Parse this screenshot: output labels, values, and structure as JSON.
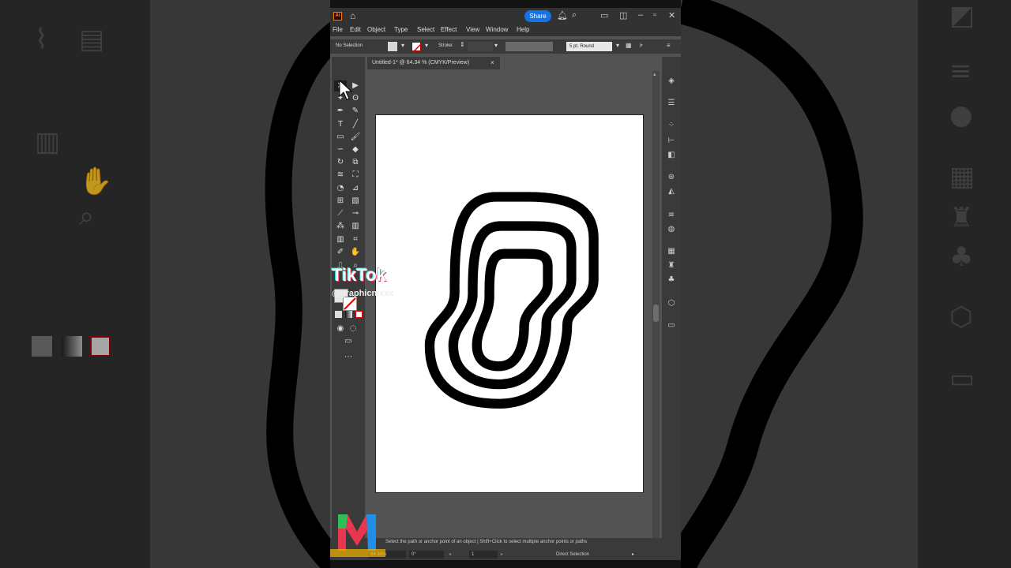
{
  "window": {
    "share_label": "Share"
  },
  "menu": [
    "File",
    "Edit",
    "Object",
    "Type",
    "Select",
    "Effect",
    "View",
    "Window",
    "Help"
  ],
  "control_bar": {
    "selection_label": "No Selection",
    "stroke_label": "Stroke:",
    "brush_label": "5 pt. Round"
  },
  "document": {
    "tab_title": "Untitled-1* @ 64.34 % (CMYK/Preview)",
    "close_label": "×"
  },
  "status": {
    "hint": "Select the path or anchor point of an object  |  Shift+Click to select multiple anchor points or paths",
    "zoom": "64.34%",
    "rotation": "0°",
    "page": "1",
    "mode": "Direct Selection"
  },
  "overlay": {
    "watermark_brand": "TikTok",
    "watermark_handle": "@graphicnixxx"
  },
  "colors": {
    "accent": "#1473e6",
    "app_bg": "#535353",
    "panel_bg": "#3a3a3a",
    "titlebar_bg": "#323232",
    "stroke": "#000000"
  },
  "icons": {
    "toolbar": [
      "selection-tool",
      "direct-selection-tool",
      "magic-wand-tool",
      "lasso-tool",
      "pen-tool",
      "curvature-tool",
      "type-tool",
      "line-tool",
      "rectangle-tool",
      "paintbrush-tool",
      "shaper-tool",
      "eraser-tool",
      "rotate-tool",
      "scale-tool",
      "warp-tool",
      "free-transform-tool",
      "shape-builder-tool",
      "perspective-tool",
      "mesh-tool",
      "gradient-tool",
      "eyedropper-tool",
      "blend-tool",
      "symbol-sprayer-tool",
      "graph-tool",
      "artboard-tool",
      "slice-tool",
      "hand-tool",
      "zoom-tool"
    ],
    "right_panel": [
      "layers-icon",
      "properties-icon",
      "libraries-icon",
      "align-icon",
      "pathfinder-icon",
      "transform-icon",
      "color-guide-icon",
      "stroke-icon",
      "appearance-icon",
      "swatches-icon",
      "brushes-icon",
      "symbols-icon",
      "3d-icon",
      "gradient-icon"
    ]
  }
}
